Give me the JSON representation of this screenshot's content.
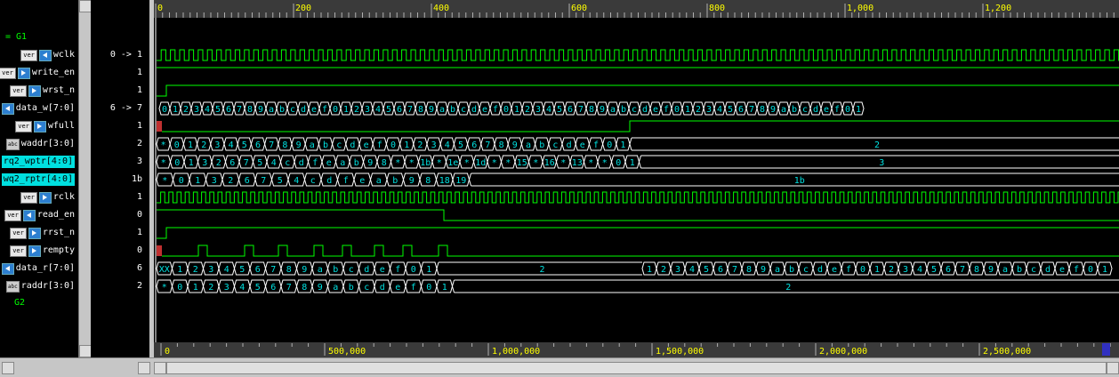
{
  "groups": [
    {
      "label": "= G1"
    },
    {
      "label": "G2"
    }
  ],
  "signals": [
    {
      "name": "wclk",
      "kind": "ver",
      "value": "0 -> 1"
    },
    {
      "name": "write_en",
      "kind": "ver",
      "value": "1"
    },
    {
      "name": "wrst_n",
      "kind": "ver",
      "value": "1"
    },
    {
      "name": "data_w[7:0]",
      "kind": "ver",
      "value": "6 -> 7"
    },
    {
      "name": "wfull",
      "kind": "ver",
      "value": "1"
    },
    {
      "name": "waddr[3:0]",
      "kind": "bus",
      "value": "2"
    },
    {
      "name": "rq2_wptr[4:0]",
      "kind": "hl",
      "value": "3"
    },
    {
      "name": "wq2_rptr[4:0]",
      "kind": "hl",
      "value": "1b"
    },
    {
      "name": "rclk",
      "kind": "ver",
      "value": "1"
    },
    {
      "name": "read_en",
      "kind": "ver",
      "value": "0"
    },
    {
      "name": "rrst_n",
      "kind": "ver",
      "value": "1"
    },
    {
      "name": "rempty",
      "kind": "ver",
      "value": "0"
    },
    {
      "name": "data_r[7:0]",
      "kind": "ver",
      "value": "6"
    },
    {
      "name": "raddr[3:0]",
      "kind": "bus",
      "value": "2"
    }
  ],
  "tag_label": "ver",
  "bus_icon_label": "abc",
  "top_ruler": [
    "0",
    "200",
    "400",
    "600",
    "800",
    "1,000",
    "1,200"
  ],
  "bottom_ruler": [
    "0",
    "500,000",
    "1,000,000",
    "1,500,000",
    "2,000,000",
    "2,500,000"
  ],
  "buses": {
    "data_w": {
      "segments": [
        "0",
        "1",
        "2",
        "3",
        "4",
        "5",
        "6",
        "7",
        "8",
        "9",
        "a",
        "b",
        "c",
        "d",
        "e",
        "f",
        "0",
        "1",
        "2",
        "3",
        "4",
        "5",
        "6",
        "7",
        "8",
        "9",
        "a",
        "b",
        "c",
        "d",
        "e",
        "f",
        "0",
        "1",
        "2",
        "3",
        "4",
        "5",
        "6",
        "7",
        "8",
        "9",
        "a",
        "b",
        "c",
        "d",
        "e",
        "f",
        "0",
        "1",
        "2",
        "3",
        "4",
        "5",
        "6",
        "7",
        "8",
        "9",
        "a",
        "b",
        "c",
        "d",
        "e",
        "f",
        "0",
        "1"
      ]
    },
    "waddr": {
      "segments": [
        "*",
        "0",
        "1",
        "2",
        "3",
        "4",
        "5",
        "6",
        "7",
        "8",
        "9",
        "a",
        "b",
        "c",
        "d",
        "e",
        "f",
        "0",
        "1",
        "2",
        "3",
        "4",
        "5",
        "6",
        "7",
        "8",
        "9",
        "a",
        "b",
        "c",
        "d",
        "e",
        "f",
        "0",
        "1"
      ],
      "final": "2"
    },
    "rq2_wptr": {
      "segments": [
        "*",
        "0",
        "1",
        "3",
        "2",
        "6",
        "7",
        "5",
        "4",
        "c",
        "d",
        "f",
        "e",
        "a",
        "b",
        "9",
        "8",
        "*",
        "*",
        "1b",
        "*",
        "1e",
        "*",
        "1d",
        "*",
        "*",
        "15",
        "*",
        "16",
        "*",
        "13",
        "*",
        "*",
        "0",
        "1"
      ],
      "final": "3"
    },
    "wq2_rptr": {
      "segments": [
        "*",
        "0",
        "1",
        "3",
        "2",
        "6",
        "7",
        "5",
        "4",
        "c",
        "d",
        "f",
        "e",
        "a",
        "b",
        "9",
        "8",
        "18",
        "19"
      ],
      "final": "1b"
    },
    "data_r": {
      "segments": [
        "XX",
        "1",
        "2",
        "3",
        "4",
        "5",
        "6",
        "7",
        "8",
        "9",
        "a",
        "b",
        "c",
        "d",
        "e",
        "f",
        "0",
        "1"
      ],
      "middle": "2",
      "tail": [
        "1",
        "2",
        "3",
        "4",
        "5",
        "6",
        "7",
        "8",
        "9",
        "a",
        "b",
        "c",
        "d",
        "e",
        "f",
        "0",
        "1",
        "2",
        "3",
        "4",
        "5",
        "6",
        "7",
        "8",
        "9",
        "a",
        "b",
        "c",
        "d",
        "e",
        "f",
        "0",
        "1"
      ]
    },
    "raddr": {
      "segments": [
        "*",
        "0",
        "1",
        "2",
        "3",
        "4",
        "5",
        "6",
        "7",
        "8",
        "9",
        "a",
        "b",
        "c",
        "d",
        "e",
        "f",
        "0",
        "1"
      ],
      "final": "2"
    }
  },
  "colors": {
    "wave": "#00ff00",
    "bus": "#ffffff",
    "text": "#00e0e0",
    "ruler": "#b0b0b0",
    "ruler_text": "#ffff00"
  }
}
